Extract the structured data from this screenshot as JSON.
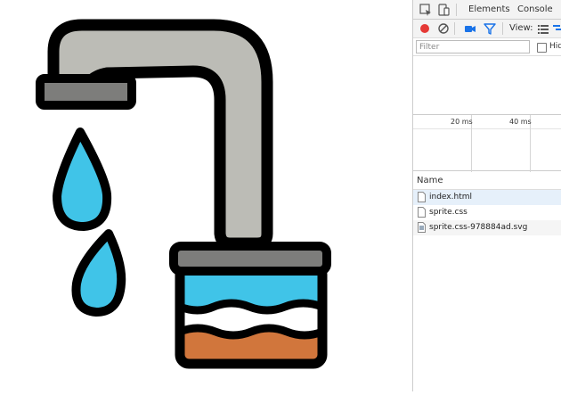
{
  "devtools": {
    "tabs": [
      "Elements",
      "Console"
    ],
    "toolbar": {
      "view_label": "View:"
    },
    "filter": {
      "placeholder": "Filter",
      "hide_label": "Hid"
    },
    "overview": {
      "ticks": [
        "20 ms",
        "40 ms"
      ]
    },
    "name_header": "Name",
    "requests": [
      {
        "name": "index.html",
        "icon": "document-icon",
        "selected": true
      },
      {
        "name": "sprite.css",
        "icon": "document-icon",
        "selected": false
      },
      {
        "name": "sprite.css-978884ad.svg",
        "icon": "image-file-icon",
        "selected": false
      }
    ]
  },
  "colors": {
    "faucet_gray": "#bcbcb6",
    "faucet_dark": "#7d7d7b",
    "water_blue": "#40c4e8",
    "sediment": "#d1763c",
    "outline": "#000000",
    "record_red": "#e53935",
    "accent_blue": "#1a73e8"
  }
}
